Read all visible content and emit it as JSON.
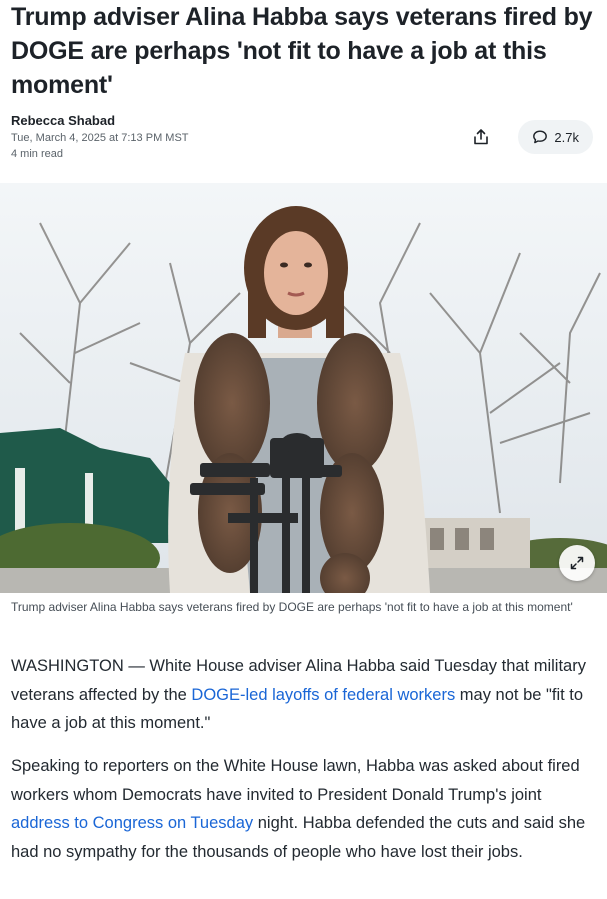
{
  "article": {
    "headline": "Trump adviser Alina Habba says veterans fired by DOGE are perhaps 'not fit to have a job at this moment'",
    "author": "Rebecca Shabad",
    "date": "Tue, March 4, 2025 at 7:13 PM MST",
    "read_time": "4 min read",
    "comment_count": "2.7k",
    "caption": "Trump adviser Alina Habba says veterans fired by DOGE are perhaps 'not fit to have a job at this moment'",
    "paragraph1": {
      "before": "WASHINGTON — White House adviser Alina Habba said Tuesday that military veterans affected by the ",
      "link": "DOGE-led layoffs of federal workers",
      "after": " may not be \"fit to have a job at this moment.\""
    },
    "paragraph2": {
      "before": "Speaking to reporters on the White House lawn, Habba was asked about fired workers whom Democrats have invited to President Donald Trump's joint ",
      "link": "address to Congress on Tuesday",
      "after": " night. Habba defended the cuts and said she had no sympathy for the thousands of people who have lost their jobs."
    }
  },
  "icons": {
    "share": "share-icon",
    "comment": "comment-icon",
    "expand": "expand-icon"
  },
  "colors": {
    "link": "#1a66d6",
    "text": "#232a31",
    "meta": "#5b636a"
  }
}
